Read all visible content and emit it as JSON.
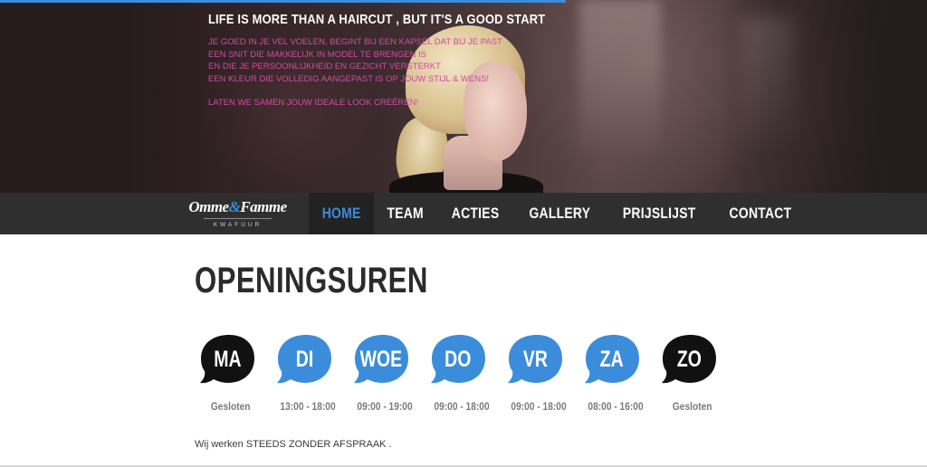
{
  "hero": {
    "title": "LIFE IS MORE THAN A HAIRCUT , BUT IT'S A GOOD START",
    "lines": [
      "JE GOED IN JE VEL VOELEN, BEGINT BIJ EEN KAPSEL DAT BIJ JE PAST",
      "EEN SNIT DIE MAKKELIJK IN MODEL TE BRENGEN IS",
      "EN DIE JE PERSOONLIJKHEID EN GEZICHT VERSTERKT",
      "EEN KLEUR DIE VOLLEDIG AANGEPAST IS OP JOUW STIJL & WENS!"
    ],
    "closing": "LATEN WE SAMEN JOUW IDEALE LOOK CREËREN!",
    "progress": 0.61,
    "accent_color": "#3b8ddb",
    "text_color": "#d24aa4"
  },
  "logo": {
    "name_part1": "Omme",
    "ampersand": "&",
    "name_part2": "Famme",
    "subtitle": "KWAFUUR"
  },
  "nav": {
    "items": [
      {
        "label": "HOME",
        "active": true
      },
      {
        "label": "TEAM",
        "active": false
      },
      {
        "label": "ACTIES",
        "active": false
      },
      {
        "label": "GALLERY",
        "active": false
      },
      {
        "label": "PRIJSLIJST",
        "active": false
      },
      {
        "label": "CONTACT",
        "active": false
      }
    ]
  },
  "content": {
    "heading": "OPENINGSUREN",
    "days": [
      {
        "label": "MA",
        "hours": "Gesloten",
        "color": "#111111"
      },
      {
        "label": "DI",
        "hours": "13:00 - 18:00",
        "color": "#3b8ddb"
      },
      {
        "label": "WOE",
        "hours": "09:00 - 19:00",
        "color": "#3b8ddb"
      },
      {
        "label": "DO",
        "hours": "09:00 - 18:00",
        "color": "#3b8ddb"
      },
      {
        "label": "VR",
        "hours": "09:00 - 18:00",
        "color": "#3b8ddb"
      },
      {
        "label": "ZA",
        "hours": "08:00 - 16:00",
        "color": "#3b8ddb"
      },
      {
        "label": "ZO",
        "hours": "Gesloten",
        "color": "#111111"
      }
    ],
    "note": "Wij werken STEEDS ZONDER AFSPRAAK ."
  }
}
